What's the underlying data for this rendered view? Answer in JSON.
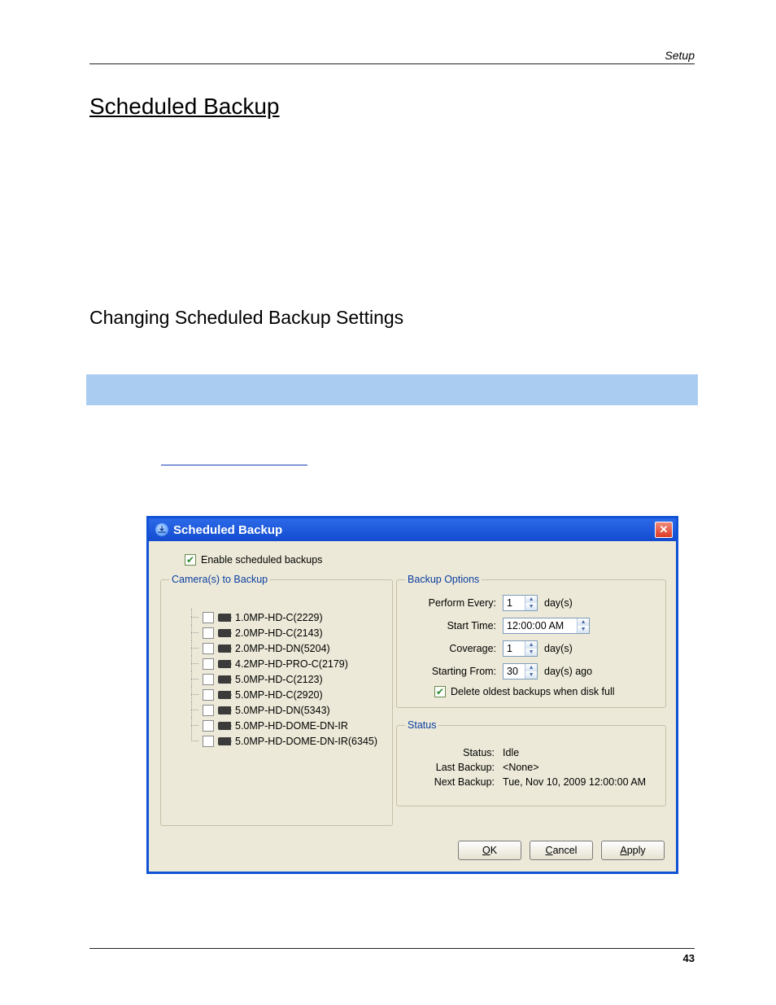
{
  "page": {
    "header_right": "Setup",
    "h1": "Scheduled Backup",
    "h2": "Changing Scheduled Backup Settings",
    "page_number": "43"
  },
  "dialog": {
    "title": "Scheduled Backup",
    "enable_label": "Enable scheduled backups",
    "cameras": {
      "legend": "Camera(s) to Backup",
      "items": [
        "1.0MP-HD-C(2229)",
        "2.0MP-HD-C(2143)",
        "2.0MP-HD-DN(5204)",
        "4.2MP-HD-PRO-C(2179)",
        "5.0MP-HD-C(2123)",
        "5.0MP-HD-C(2920)",
        "5.0MP-HD-DN(5343)",
        "5.0MP-HD-DOME-DN-IR",
        "5.0MP-HD-DOME-DN-IR(6345)"
      ]
    },
    "options": {
      "legend": "Backup Options",
      "perform_every_label": "Perform Every:",
      "perform_every_value": "1",
      "perform_every_suffix": "day(s)",
      "start_time_label": "Start Time:",
      "start_time_value": "12:00:00 AM",
      "coverage_label": "Coverage:",
      "coverage_value": "1",
      "coverage_suffix": "day(s)",
      "starting_from_label": "Starting From:",
      "starting_from_value": "30",
      "starting_from_suffix": "day(s) ago",
      "delete_label": "Delete oldest backups when disk full"
    },
    "status": {
      "legend": "Status",
      "status_label": "Status:",
      "status_value": "Idle",
      "last_label": "Last Backup:",
      "last_value": "<None>",
      "next_label": "Next Backup:",
      "next_value": "Tue, Nov 10, 2009 12:00:00 AM"
    },
    "buttons": {
      "ok": "OK",
      "cancel": "Cancel",
      "apply": "Apply"
    }
  }
}
